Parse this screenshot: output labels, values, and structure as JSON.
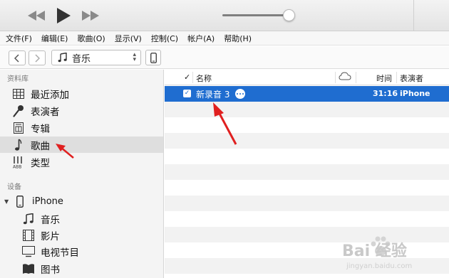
{
  "player": {
    "icons": [
      "rewind-icon",
      "play-icon",
      "fast-forward-icon"
    ],
    "volume_fraction": 0.93
  },
  "menu": {
    "items": [
      "文件(F)",
      "编辑(E)",
      "歌曲(O)",
      "显示(V)",
      "控制(C)",
      "帐户(A)",
      "帮助(H)"
    ]
  },
  "nav": {
    "back_icon": "chevron-left-icon",
    "forward_icon": "chevron-right-icon",
    "media_select_value": "音乐",
    "device_icon": "iphone-icon"
  },
  "sidebar": {
    "library_title": "资料库",
    "library_items": [
      {
        "label": "最近添加",
        "icon": "grid-icon"
      },
      {
        "label": "表演者",
        "icon": "microphone-icon"
      },
      {
        "label": "专辑",
        "icon": "album-icon"
      },
      {
        "label": "歌曲",
        "icon": "music-note-icon",
        "selected": true
      },
      {
        "label": "类型",
        "icon": "genre-icon"
      }
    ],
    "devices_title": "设备",
    "device_name": "iPhone",
    "device_items": [
      {
        "label": "音乐",
        "icon": "music-icon"
      },
      {
        "label": "影片",
        "icon": "film-icon"
      },
      {
        "label": "电视节目",
        "icon": "tv-icon"
      },
      {
        "label": "图书",
        "icon": "book-icon"
      }
    ]
  },
  "table": {
    "headers": {
      "check": "✓",
      "name": "名称",
      "cloud_icon": "cloud-icon",
      "time": "时间",
      "artist": "表演者"
    },
    "rows": [
      {
        "checked": true,
        "name": "新录音 3",
        "time": "31:16",
        "artist": "iPhone"
      }
    ]
  },
  "watermark": {
    "text": "Bai 经验",
    "url": "jingyan.baidu.com"
  },
  "colors": {
    "selection": "#1f6dd0",
    "arrow": "#e02020",
    "sidebar_bg": "#f4f4f4"
  }
}
